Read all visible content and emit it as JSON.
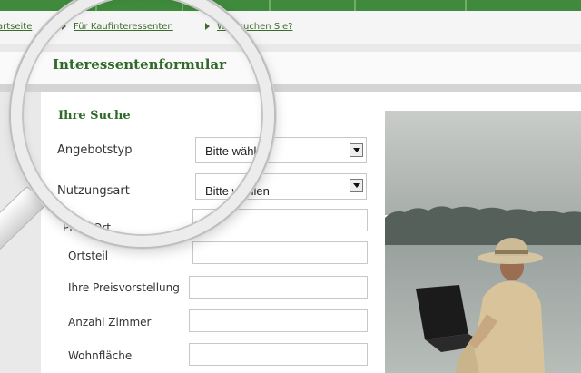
{
  "breadcrumb": {
    "items": [
      "artseite",
      "Für Kaufinteressenten",
      "Was suchen Sie?"
    ]
  },
  "page": {
    "title": "Interessentenformular"
  },
  "form": {
    "section_title": "Ihre Suche",
    "fields": [
      {
        "label": "Angebotstyp",
        "type": "select",
        "value": "Bitte wählen"
      },
      {
        "label": "Nutzungsart",
        "type": "select",
        "value": "Bitte wählen"
      },
      {
        "label": "PLZ / Ort",
        "type": "text",
        "value": ""
      },
      {
        "label": "Ortsteil",
        "type": "text",
        "value": ""
      },
      {
        "label": "Ihre Preisvorstellung",
        "type": "text",
        "value": ""
      },
      {
        "label": "Anzahl Zimmer",
        "type": "text",
        "value": ""
      },
      {
        "label": "Wohnfläche",
        "type": "text",
        "value": ""
      }
    ]
  },
  "colors": {
    "brand_green": "#3f8a3c",
    "heading_green": "#2f6a2a"
  },
  "icons": [
    "breadcrumb-arrow-icon",
    "dropdown-arrow-icon",
    "magnifier-icon"
  ]
}
